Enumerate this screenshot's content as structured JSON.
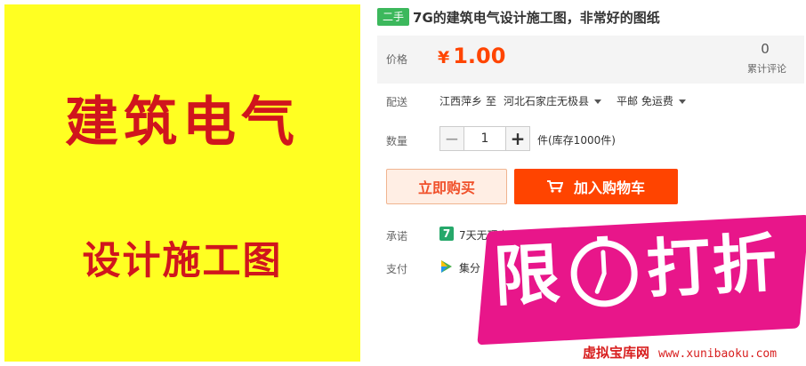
{
  "product_image": {
    "line1": "建筑电气",
    "line2": "设计施工图",
    "background": "#ffff22",
    "text_color": "#d0151d"
  },
  "title": {
    "badge": "二手",
    "text": "7G的建筑电气设计施工图，非常好的图纸"
  },
  "price": {
    "label": "价格",
    "currency": "¥",
    "amount": "1.00",
    "review_count": "0",
    "review_label": "累计评论"
  },
  "delivery": {
    "label": "配送",
    "from": "江西萍乡",
    "to_word": "至",
    "destination": "河北石家庄无极县",
    "shipping": "平邮 免运费"
  },
  "quantity": {
    "label": "数量",
    "minus": "−",
    "value": "1",
    "plus": "+",
    "stock": "件(库存1000件)"
  },
  "actions": {
    "buy_now": "立即购买",
    "add_to_cart": "加入购物车"
  },
  "promise": {
    "label": "承诺",
    "icon": "7",
    "text": "7天无理由"
  },
  "payment": {
    "label": "支付",
    "text": "集分"
  },
  "promo": {
    "char1": "限",
    "char2": "打折",
    "watermark_name": "虚拟宝库网",
    "watermark_url": "www.xunibaoku.com",
    "color": "#e8168a"
  },
  "colors": {
    "accent": "#ff4400",
    "price": "#ff4500",
    "badge": "#3cb85c"
  }
}
